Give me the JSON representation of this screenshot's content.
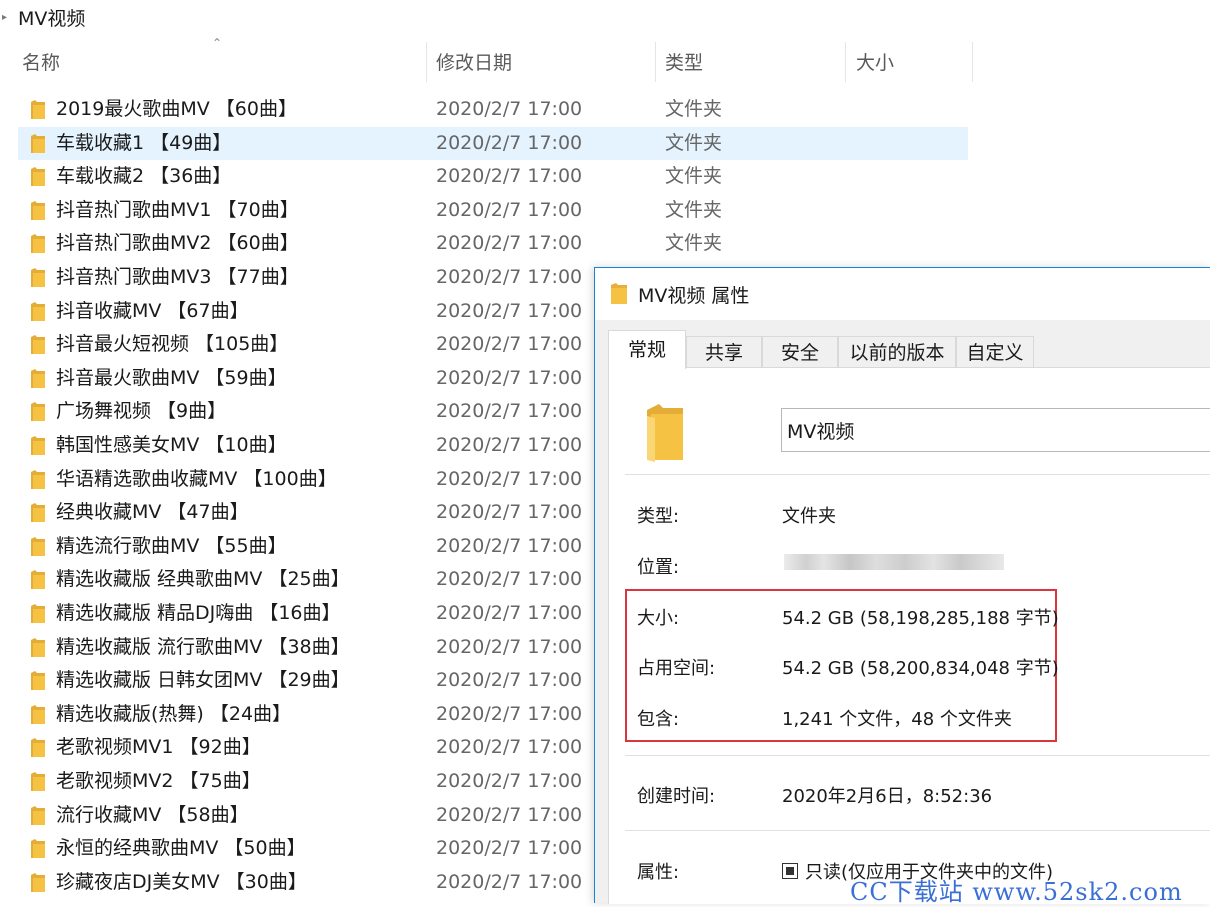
{
  "breadcrumb": {
    "path": "MV视频"
  },
  "columns": {
    "name": "名称",
    "date": "修改日期",
    "type": "类型",
    "size": "大小"
  },
  "files": [
    {
      "name": "2019最火歌曲MV 【60曲】",
      "date": "2020/2/7 17:00",
      "type": "文件夹"
    },
    {
      "name": "车载收藏1 【49曲】",
      "date": "2020/2/7 17:00",
      "type": "文件夹",
      "selected": true
    },
    {
      "name": "车载收藏2 【36曲】",
      "date": "2020/2/7 17:00",
      "type": "文件夹"
    },
    {
      "name": "抖音热门歌曲MV1 【70曲】",
      "date": "2020/2/7 17:00",
      "type": "文件夹"
    },
    {
      "name": "抖音热门歌曲MV2 【60曲】",
      "date": "2020/2/7 17:00",
      "type": "文件夹"
    },
    {
      "name": "抖音热门歌曲MV3 【77曲】",
      "date": "2020/2/7 17:00",
      "type": "文件夹"
    },
    {
      "name": "抖音收藏MV 【67曲】",
      "date": "2020/2/7 17:00",
      "type": ""
    },
    {
      "name": "抖音最火短视频 【105曲】",
      "date": "2020/2/7 17:00",
      "type": ""
    },
    {
      "name": "抖音最火歌曲MV 【59曲】",
      "date": "2020/2/7 17:00",
      "type": ""
    },
    {
      "name": "广场舞视频 【9曲】",
      "date": "2020/2/7 17:00",
      "type": ""
    },
    {
      "name": "韩国性感美女MV 【10曲】",
      "date": "2020/2/7 17:00",
      "type": ""
    },
    {
      "name": "华语精选歌曲收藏MV 【100曲】",
      "date": "2020/2/7 17:00",
      "type": ""
    },
    {
      "name": "经典收藏MV 【47曲】",
      "date": "2020/2/7 17:00",
      "type": ""
    },
    {
      "name": "精选流行歌曲MV 【55曲】",
      "date": "2020/2/7 17:00",
      "type": ""
    },
    {
      "name": "精选收藏版 经典歌曲MV 【25曲】",
      "date": "2020/2/7 17:00",
      "type": ""
    },
    {
      "name": "精选收藏版 精品DJ嗨曲 【16曲】",
      "date": "2020/2/7 17:00",
      "type": ""
    },
    {
      "name": "精选收藏版 流行歌曲MV 【38曲】",
      "date": "2020/2/7 17:00",
      "type": ""
    },
    {
      "name": "精选收藏版 日韩女团MV 【29曲】",
      "date": "2020/2/7 17:00",
      "type": ""
    },
    {
      "name": "精选收藏版(热舞) 【24曲】",
      "date": "2020/2/7 17:00",
      "type": ""
    },
    {
      "name": "老歌视频MV1 【92曲】",
      "date": "2020/2/7 17:00",
      "type": ""
    },
    {
      "name": "老歌视频MV2 【75曲】",
      "date": "2020/2/7 17:00",
      "type": ""
    },
    {
      "name": "流行收藏MV 【58曲】",
      "date": "2020/2/7 17:00",
      "type": ""
    },
    {
      "name": "永恒的经典歌曲MV 【50曲】",
      "date": "2020/2/7 17:00",
      "type": ""
    },
    {
      "name": "珍藏夜店DJ美女MV 【30曲】",
      "date": "2020/2/7 17:00",
      "type": ""
    }
  ],
  "dialog": {
    "title": "MV视频 属性",
    "tabs": [
      "常规",
      "共享",
      "安全",
      "以前的版本",
      "自定义"
    ],
    "folder_name": "MV视频",
    "type_label": "类型:",
    "type_value": "文件夹",
    "location_label": "位置:",
    "size_label": "大小:",
    "size_value": "54.2 GB (58,198,285,188 字节)",
    "disk_label": "占用空间:",
    "disk_value": "54.2 GB (58,200,834,048 字节)",
    "contains_label": "包含:",
    "contains_value": "1,241 个文件，48 个文件夹",
    "created_label": "创建时间:",
    "created_value": "2020年2月6日，8:52:36",
    "attributes_label": "属性:",
    "readonly_label": "只读(仅应用于文件夹中的文件)"
  },
  "watermark": "CC下载站 www.52sk2.com",
  "colors": {
    "selection": "#e5f3ff",
    "folder": "#f5c243",
    "accent": "#1883d7",
    "highlight_box": "#d9363e",
    "watermark": "#3a6fd6"
  }
}
